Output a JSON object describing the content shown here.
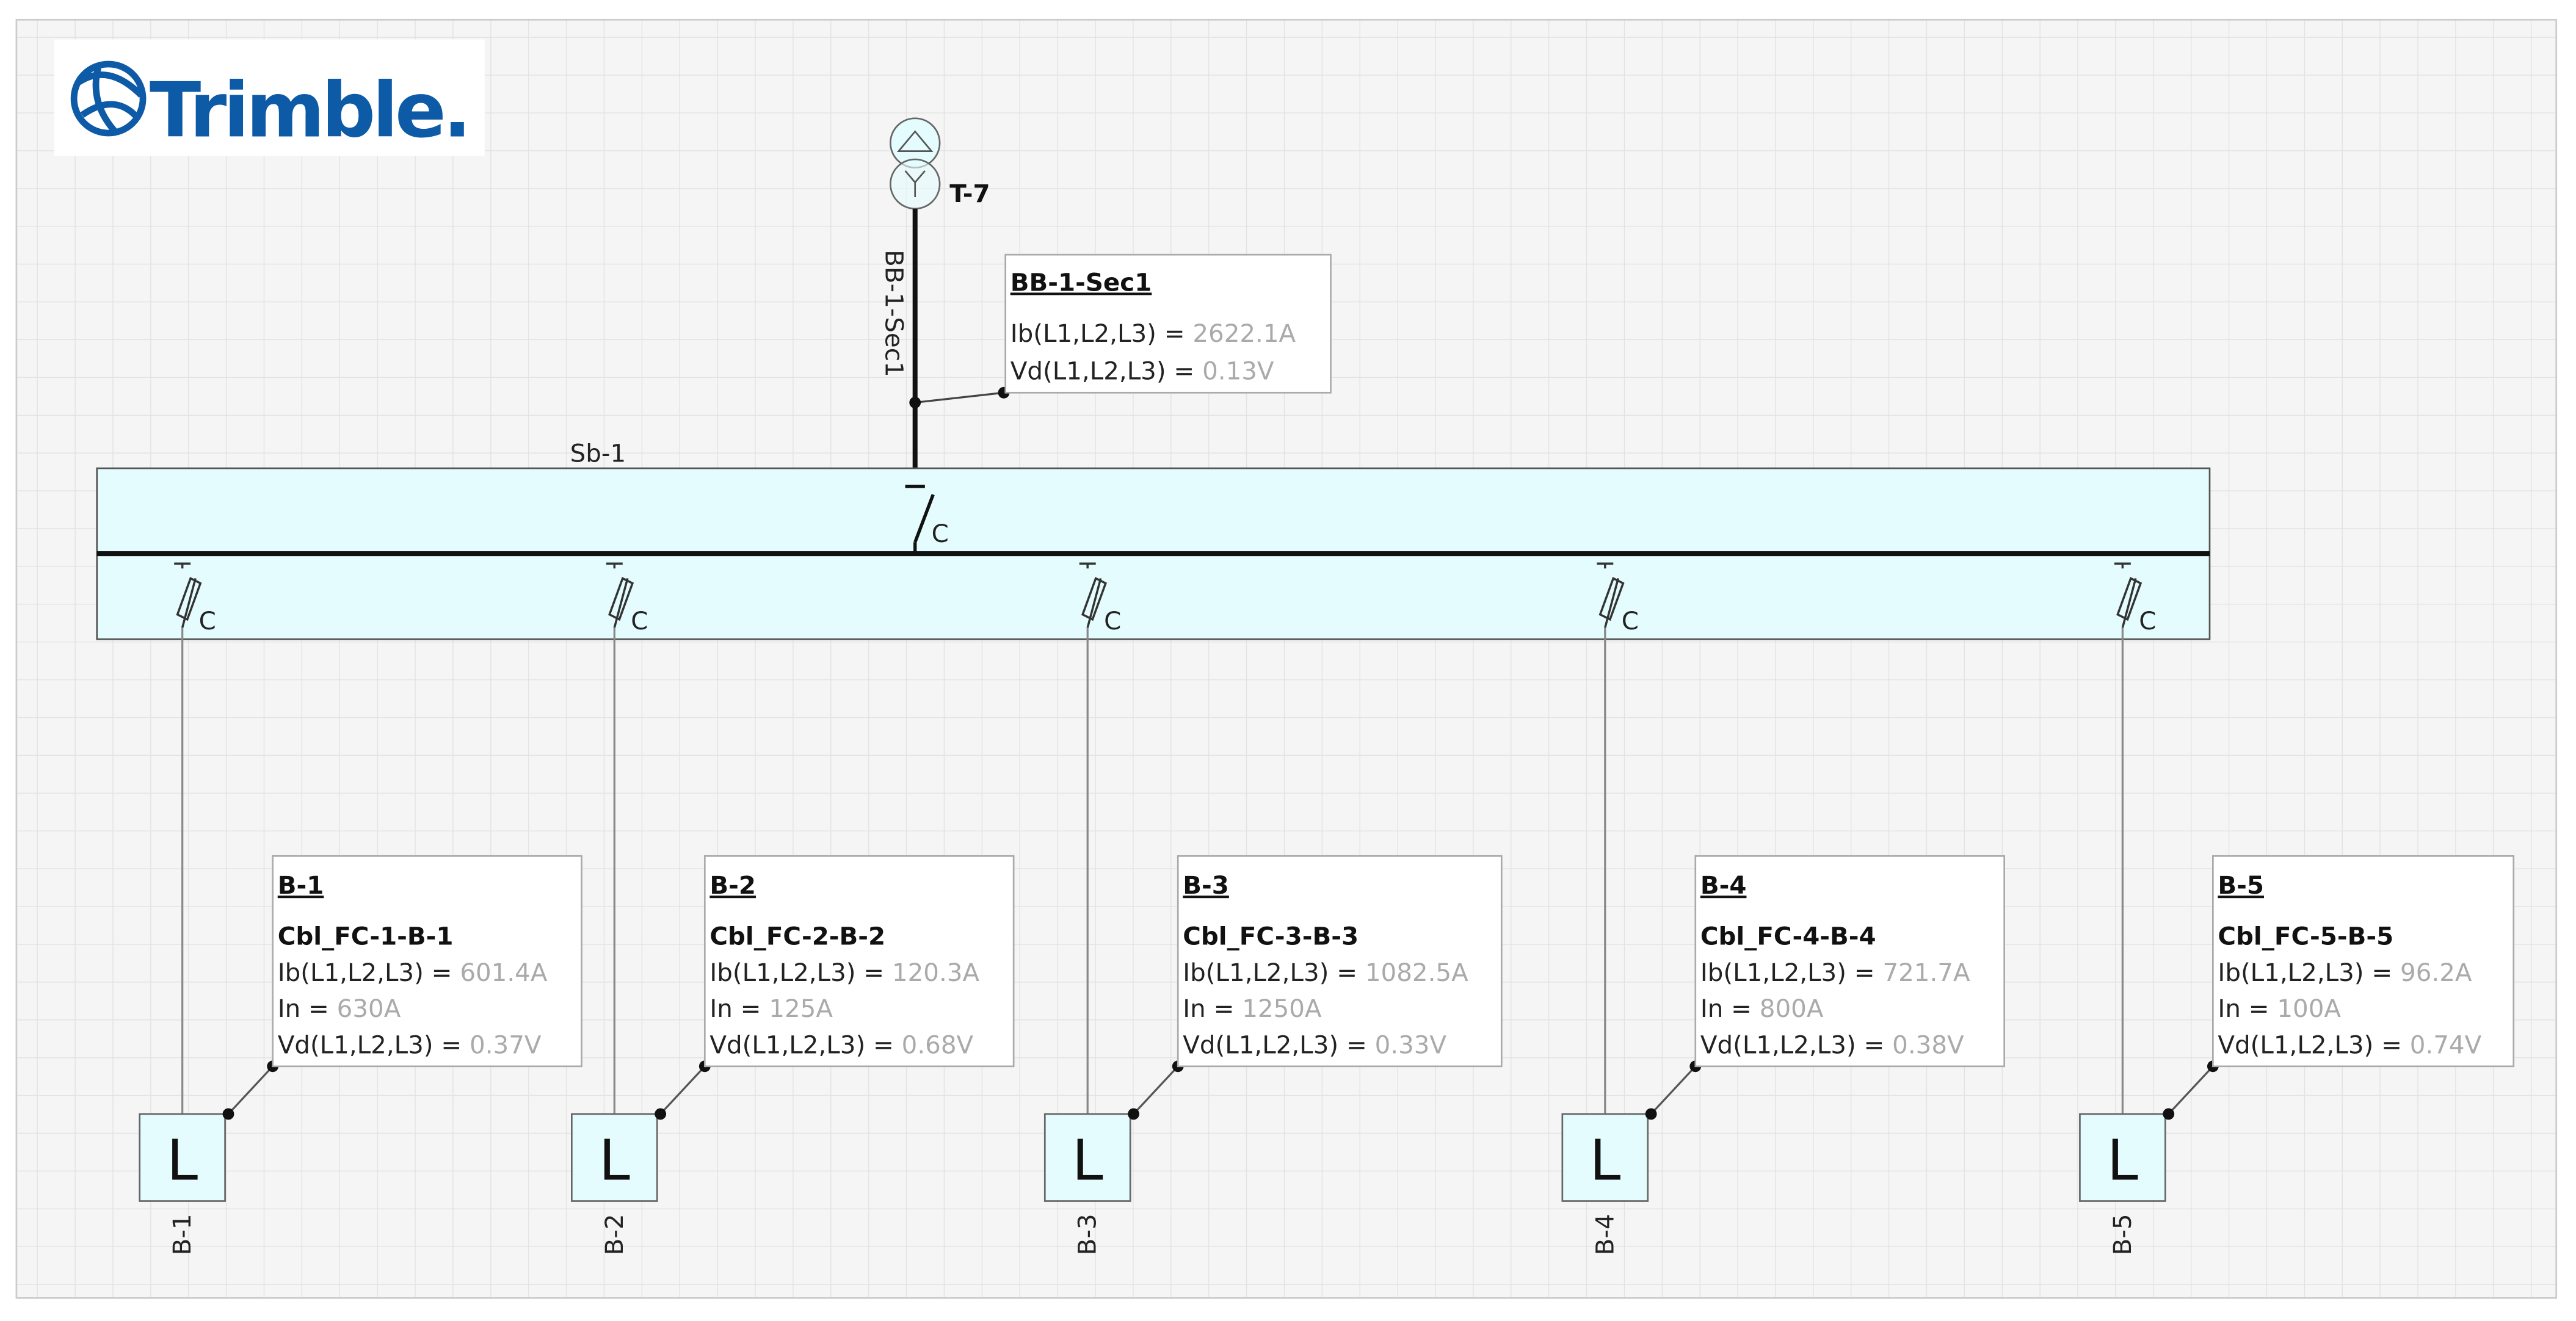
{
  "logo": {
    "text": "Trimble."
  },
  "transformer": {
    "label": "T-7"
  },
  "busbar": {
    "label": "BB-1-Sec1",
    "info": {
      "title": "BB-1-Sec1",
      "ib_label": "Ib(L1,L2,L3) = ",
      "ib_value": "2622.1A",
      "vd_label": "Vd(L1,L2,L3) = ",
      "vd_value": "0.13V"
    }
  },
  "switchboard": {
    "label": "Sb-1",
    "main_switch_label": "C"
  },
  "feeders": [
    {
      "load": "B-1",
      "cable": "Cbl_FC-1-B-1",
      "ib": "601.4A",
      "in": "630A",
      "vd": "0.37V",
      "fuse_label": "C",
      "load_symbol": "L"
    },
    {
      "load": "B-2",
      "cable": "Cbl_FC-2-B-2",
      "ib": "120.3A",
      "in": "125A",
      "vd": "0.68V",
      "fuse_label": "C",
      "load_symbol": "L"
    },
    {
      "load": "B-3",
      "cable": "Cbl_FC-3-B-3",
      "ib": "1082.5A",
      "in": "1250A",
      "vd": "0.33V",
      "fuse_label": "C",
      "load_symbol": "L"
    },
    {
      "load": "B-4",
      "cable": "Cbl_FC-4-B-4",
      "ib": "721.7A",
      "in": "800A",
      "vd": "0.38V",
      "fuse_label": "C",
      "load_symbol": "L"
    },
    {
      "load": "B-5",
      "cable": "Cbl_FC-5-B-5",
      "ib": "96.2A",
      "in": "100A",
      "vd": "0.74V",
      "fuse_label": "C",
      "load_symbol": "L"
    }
  ],
  "labels": {
    "ib": "Ib(L1,L2,L3) = ",
    "in": "In = ",
    "vd": "Vd(L1,L2,L3) = "
  },
  "colors": {
    "panel_fill": "#e4fcfd",
    "value_gray": "#aaaaaa",
    "logo_blue": "#0d5aa7"
  }
}
